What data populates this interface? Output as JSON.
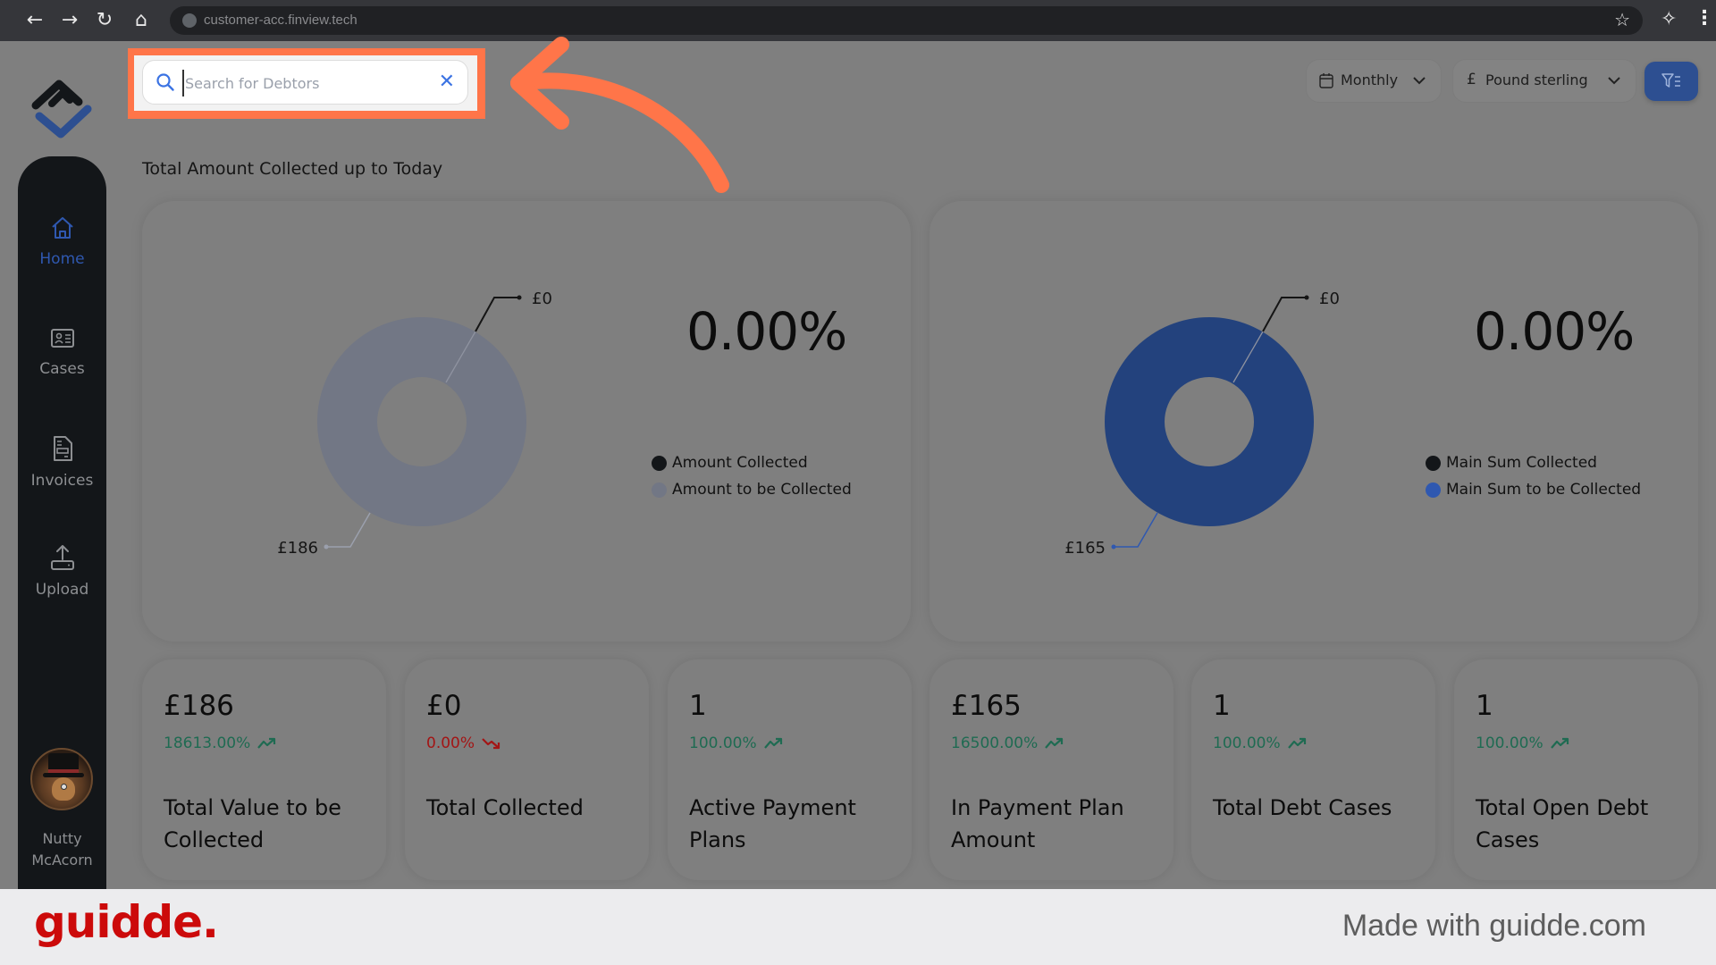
{
  "browser": {
    "url": "customer-acc.finview.tech",
    "nav_icons": [
      "back-icon",
      "forward-icon",
      "reload-icon",
      "home-icon"
    ]
  },
  "search": {
    "placeholder": "Search for Debtors",
    "value": ""
  },
  "controls": {
    "period": "Monthly",
    "currency_symbol": "£",
    "currency": "Pound sterling"
  },
  "sidebar": {
    "items": [
      {
        "label": "Home",
        "icon": "home-icon",
        "active": true
      },
      {
        "label": "Cases",
        "icon": "id-card-icon",
        "active": false
      },
      {
        "label": "Invoices",
        "icon": "invoice-icon",
        "active": false
      },
      {
        "label": "Upload",
        "icon": "upload-icon",
        "active": false
      }
    ],
    "user": {
      "first": "Nutty",
      "last": "McAcorn"
    }
  },
  "section_title": "Total Amount Collected up to Today",
  "colors": {
    "accent": "#2d4f91",
    "donut_grey": "#727785",
    "donut_blue": "#23427d",
    "collected": "#131619",
    "positive": "#1f6b52",
    "negative": "#a31515",
    "annotation": "#ff7549"
  },
  "chart_data": [
    {
      "type": "pie",
      "title": "Total Amount Collected up to Today",
      "percentage_label": "0.00%",
      "series": [
        {
          "name": "Amount Collected",
          "value": 0,
          "label": "£0",
          "color": "#131619"
        },
        {
          "name": "Amount to be Collected",
          "value": 186,
          "label": "£186",
          "color": "#727785"
        }
      ],
      "legend": "right"
    },
    {
      "type": "pie",
      "title": "",
      "percentage_label": "0.00%",
      "series": [
        {
          "name": "Main Sum Collected",
          "value": 0,
          "label": "£0",
          "color": "#131619"
        },
        {
          "name": "Main Sum to be Collected",
          "value": 165,
          "label": "£165",
          "color": "#23427d"
        }
      ],
      "legend": "right"
    }
  ],
  "cards": [
    {
      "value": "£186",
      "change": "18613.00%",
      "trend": "up",
      "label": "Total Value to be Collected"
    },
    {
      "value": "£0",
      "change": "0.00%",
      "trend": "down",
      "label": "Total Collected"
    },
    {
      "value": "1",
      "change": "100.00%",
      "trend": "up",
      "label": "Active Payment Plans"
    },
    {
      "value": "£165",
      "change": "16500.00%",
      "trend": "up",
      "label": "In Payment Plan Amount"
    },
    {
      "value": "1",
      "change": "100.00%",
      "trend": "up",
      "label": "Total Debt Cases"
    },
    {
      "value": "1",
      "change": "100.00%",
      "trend": "up",
      "label": "Total Open Debt Cases"
    }
  ],
  "footer": {
    "brand": "guidde.",
    "made_with": "Made with guidde.com"
  }
}
